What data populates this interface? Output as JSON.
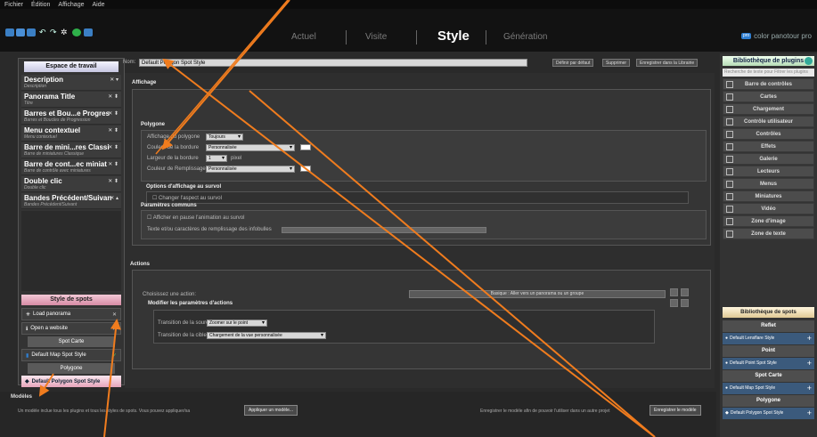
{
  "menubar": {
    "items": [
      "Fichier",
      "Édition",
      "Affichage",
      "Aide"
    ]
  },
  "toolbar": {
    "tabs": [
      "Actuel",
      "Visite",
      "Style",
      "Génération"
    ],
    "brand": "color panotour pro",
    "brand_icon": "pro-logo-icon",
    "icons": [
      "new-project-icon",
      "save-icon",
      "save-as-icon",
      "undo-icon",
      "redo-icon",
      "settings-icon",
      "play-icon",
      "screen-icon"
    ]
  },
  "left_panel": {
    "header": "Espace de travail",
    "items": [
      {
        "title": "Description",
        "subtitle": "Description",
        "controls": "✕ ▾"
      },
      {
        "title": "Panorama Title",
        "subtitle": "Titre",
        "controls": "✕ ⬍"
      },
      {
        "title": "Barres et Bou...e Progres",
        "subtitle": "Barres et Boucles de Progression",
        "controls": "✕ ⬍"
      },
      {
        "title": "Menu contextuel",
        "subtitle": "Menu contextuel",
        "controls": "✕ ⬍"
      },
      {
        "title": "Barre de mini...res Classi",
        "subtitle": "Barre de miniatures Classique",
        "controls": "✕ ⬍"
      },
      {
        "title": "Barre de cont...ec miniat",
        "subtitle": "Barre de contrôle avec miniatures",
        "controls": "✕ ⬍"
      },
      {
        "title": "Double clic",
        "subtitle": "Double clic",
        "controls": "✕ ⬍"
      },
      {
        "title": "Bandes Précédent/Suivan",
        "subtitle": "Bandes Précédent/Suivant",
        "controls": "✕ ▴"
      }
    ],
    "spot_header": "Style de spots",
    "spots": [
      {
        "label": "Load panorama",
        "icon": "load-panorama-icon"
      },
      {
        "label": "Open a website",
        "icon": "info-icon"
      }
    ],
    "spot_cat_carte": "Spot Carte",
    "map_spot": "Default Map Spot Style",
    "spot_cat_polygone": "Polygone",
    "selected_spot": "Default Polygon Spot Style"
  },
  "header_row": {
    "name_label": "Nom:",
    "name_value": "Default Polygon Spot Style",
    "buttons": [
      "Définir par défaut",
      "Supprimer",
      "Enregistrer dans la Librairie"
    ]
  },
  "center": {
    "affichage": "Affichage",
    "polygone": "Polygone",
    "rows": [
      {
        "label": "Affichage du polygone",
        "value": "Toujours"
      },
      {
        "label": "Couleur de la bordure",
        "value": "Personnalisée"
      },
      {
        "label": "Largeur de la bordure",
        "value": "1",
        "unit": "pixel"
      },
      {
        "label": "Couleur de Remplissage",
        "value": "Personnalisée"
      }
    ],
    "survol_title": "Options d'affichage au survol",
    "survol_check": "Changer l'aspect au survol",
    "params_title": "Paramètres communs",
    "params_rows": [
      "Afficher en pause l'animation au survol",
      "Texte et/ou caractères de remplissage des infobulles"
    ],
    "actions_title": "Actions",
    "choose_action": "Choisissez une action:",
    "action_value": "Basique : Aller vers un panorama ou un groupe",
    "modify_title": "Modifier les paramètres d'actions",
    "transition_source_label": "Transition de la source",
    "transition_source_value": "Zoomer sur le point",
    "transition_target_label": "Transition de la cible",
    "transition_target_value": "Chargement de la vue personnalisée"
  },
  "right_panel": {
    "header": "Bibliothèque de plugins",
    "search_placeholder": "Recherche de texte pour Filtrer les plugins",
    "plugins": [
      {
        "label": "Barre de contrôles",
        "icon": "control-bar-icon"
      },
      {
        "label": "Cartes",
        "icon": "map-icon"
      },
      {
        "label": "Chargement",
        "icon": "loading-icon"
      },
      {
        "label": "Contrôle utilisateur",
        "icon": "user-icon"
      },
      {
        "label": "Contrôles",
        "icon": "controls-icon"
      },
      {
        "label": "Effets",
        "icon": "effects-icon"
      },
      {
        "label": "Galerie",
        "icon": "gallery-icon"
      },
      {
        "label": "Lecteurs",
        "icon": "players-icon"
      },
      {
        "label": "Menus",
        "icon": "menu-icon"
      },
      {
        "label": "Miniatures",
        "icon": "thumbnails-icon"
      },
      {
        "label": "Vidéo",
        "icon": "video-icon"
      },
      {
        "label": "Zone d'image",
        "icon": "image-zone-icon"
      },
      {
        "label": "Zone de texte",
        "icon": "text-zone-icon"
      }
    ],
    "spot_lib_header": "Bibliothèque de spots",
    "spot_lib": [
      {
        "type": "cat",
        "label": "Reflet"
      },
      {
        "type": "spot",
        "label": "Default Lensflare Style"
      },
      {
        "type": "cat",
        "label": "Point"
      },
      {
        "type": "spot",
        "label": "Default Point Spot Style"
      },
      {
        "type": "cat",
        "label": "Spot Carte"
      },
      {
        "type": "spot",
        "label": "Default Map Spot Style"
      },
      {
        "type": "cat",
        "label": "Polygone"
      },
      {
        "type": "spot",
        "label": "Default Polygon Spot Style"
      }
    ]
  },
  "modeles": {
    "title": "Modèles",
    "text": "Un modèle inclue tous les plugins et tous les styles de spots. Vous pouvez appliquer/sa",
    "apply_btn": "Appliquer un modèle...",
    "right_text": "Enregistrer le modèle afin de pouvoir l'utiliser dans un autre projet",
    "save_btn": "Enregistrer le modèle"
  },
  "colors": {
    "arrow": "#f07c1e",
    "accent": "#2f7fd2"
  }
}
